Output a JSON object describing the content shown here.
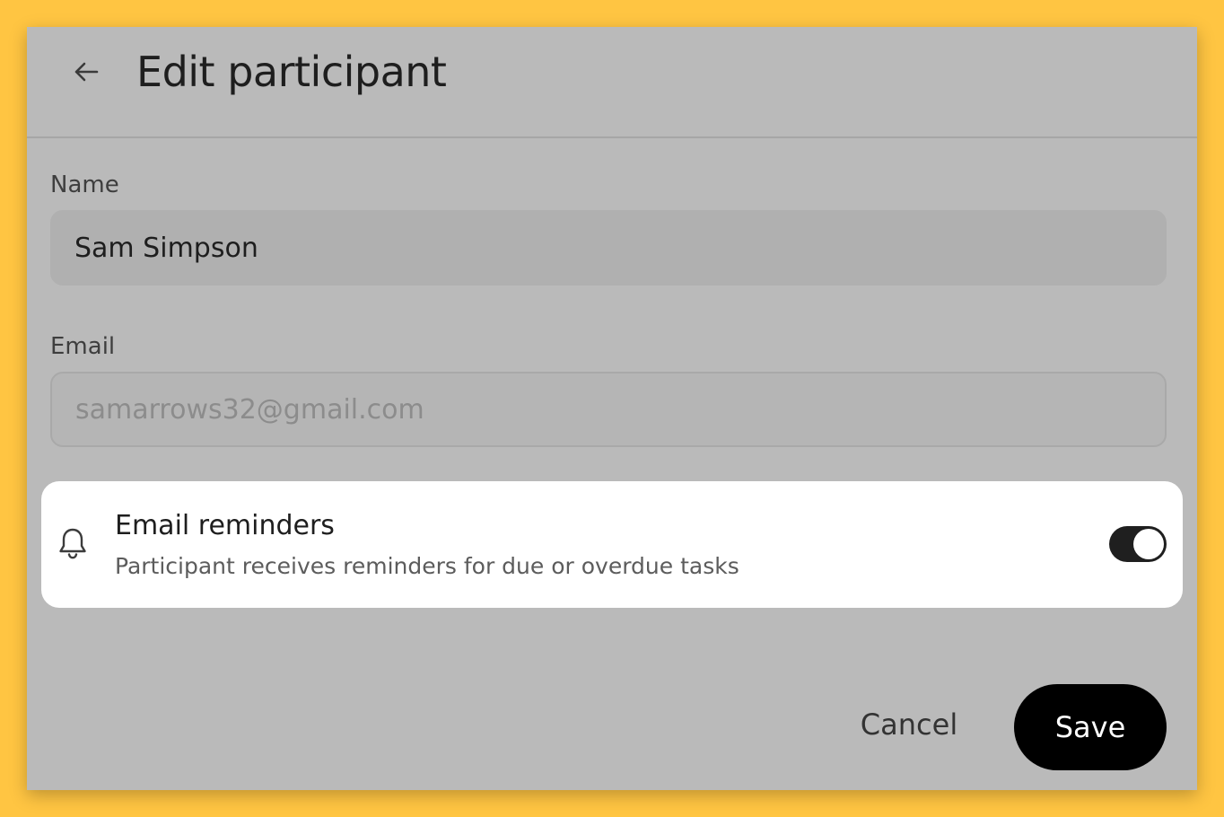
{
  "header": {
    "title": "Edit participant",
    "back_icon": "arrow-left-icon"
  },
  "form": {
    "name": {
      "label": "Name",
      "value": "Sam Simpson"
    },
    "email": {
      "label": "Email",
      "placeholder": "samarrows32@gmail.com"
    }
  },
  "reminders": {
    "icon": "bell-icon",
    "title": "Email reminders",
    "description": "Participant receives reminders for due or overdue tasks",
    "enabled": true
  },
  "actions": {
    "cancel_label": "Cancel",
    "save_label": "Save"
  },
  "colors": {
    "background": "#FFC542",
    "panel": "#BABABA",
    "primary_button": "#000000",
    "toggle_on": "#1F1F1F"
  }
}
